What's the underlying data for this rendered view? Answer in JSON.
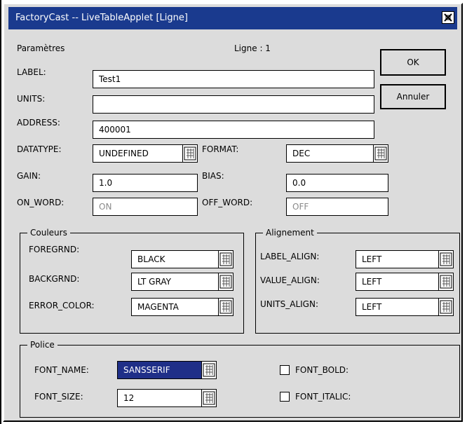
{
  "window": {
    "title": "FactoryCast -- LiveTableApplet [Ligne]"
  },
  "header": {
    "params_label": "Paramètres",
    "ligne_label": "Ligne : 1"
  },
  "buttons": {
    "ok": "OK",
    "cancel": "Annuler"
  },
  "fields": {
    "label": {
      "name": "LABEL:",
      "value": "Test1"
    },
    "units": {
      "name": "UNITS:",
      "value": ""
    },
    "address": {
      "name": "ADDRESS:",
      "value": "400001"
    },
    "datatype": {
      "name": "DATATYPE:",
      "value": "UNDEFINED"
    },
    "format": {
      "name": "FORMAT:",
      "value": "DEC"
    },
    "gain": {
      "name": "GAIN:",
      "value": "1.0"
    },
    "bias": {
      "name": "BIAS:",
      "value": "0.0"
    },
    "on_word": {
      "name": "ON_WORD:",
      "value": "ON"
    },
    "off_word": {
      "name": "OFF_WORD:",
      "value": "OFF"
    }
  },
  "colors_group": {
    "title": "Couleurs",
    "foregrnd": {
      "name": "FOREGRND:",
      "value": "BLACK"
    },
    "backgrnd": {
      "name": "BACKGRND:",
      "value": "LT GRAY"
    },
    "error_color": {
      "name": "ERROR_COLOR:",
      "value": "MAGENTA"
    }
  },
  "align_group": {
    "title": "Alignement",
    "label_align": {
      "name": "LABEL_ALIGN:",
      "value": "LEFT"
    },
    "value_align": {
      "name": "VALUE_ALIGN:",
      "value": "LEFT"
    },
    "units_align": {
      "name": "UNITS_ALIGN:",
      "value": "LEFT"
    }
  },
  "font_group": {
    "title": "Police",
    "font_name": {
      "name": "FONT_NAME:",
      "value": "SANSSERIF"
    },
    "font_size": {
      "name": "FONT_SIZE:",
      "value": "12"
    },
    "font_bold": {
      "name": "FONT_BOLD:",
      "checked": false
    },
    "font_italic": {
      "name": "FONT_ITALIC:",
      "checked": false
    }
  },
  "icons": {
    "close": "close-icon",
    "dropdown": "dropdown-arrow-icon"
  },
  "colors": {
    "titlebar": "#1a3a8e",
    "dialog_bg": "#dcdcdc",
    "selection": "#1f2f88"
  }
}
